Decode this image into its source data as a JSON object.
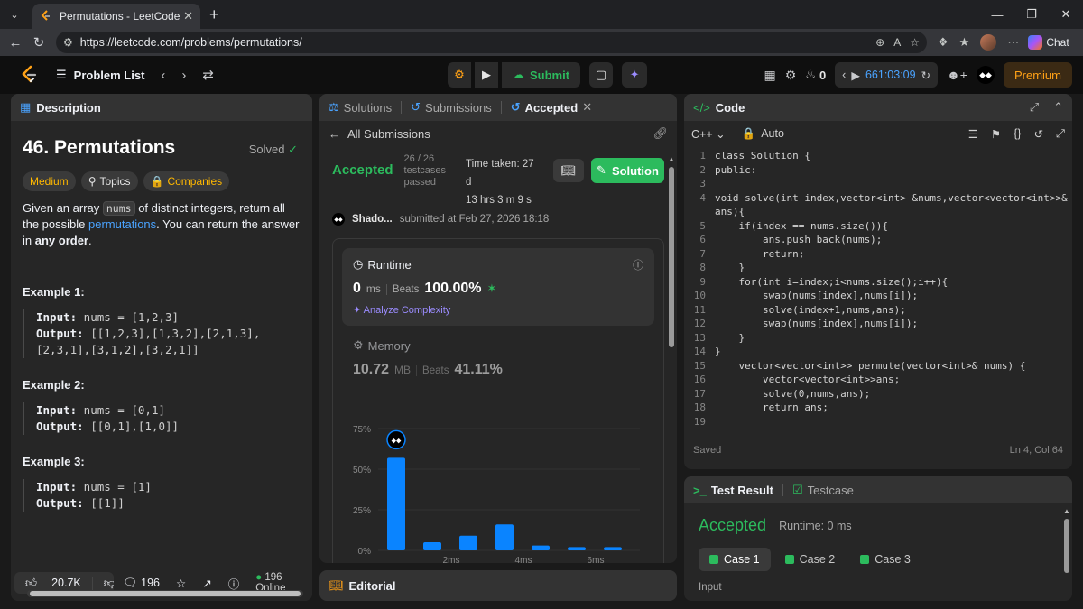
{
  "browser": {
    "tab_title": "Permutations - LeetCode",
    "url": "https://leetcode.com/problems/permutations/",
    "chat_label": "Chat"
  },
  "header": {
    "problem_list": "Problem List",
    "submit": "Submit",
    "streak": "0",
    "timer": "661:03:09",
    "premium": "Premium"
  },
  "description": {
    "tab": "Description",
    "title": "46. Permutations",
    "solved": "Solved",
    "difficulty": "Medium",
    "topics": "Topics",
    "companies": "Companies",
    "text_1": "Given an array ",
    "code_nums": "nums",
    "text_2": " of distinct integers, return all the possible ",
    "link": "permutations",
    "text_3": ". You can return the answer in ",
    "bold": "any order",
    "text_4": ".",
    "examples": [
      {
        "title": "Example 1:",
        "input_label": "Input:",
        "input": " nums = [1,2,3]",
        "output_label": "Output:",
        "output": " [[1,2,3],[1,3,2],[2,1,3],",
        "output_cont": "[2,3,1],[3,1,2],[3,2,1]]"
      },
      {
        "title": "Example 2:",
        "input_label": "Input:",
        "input": " nums = [0,1]",
        "output_label": "Output:",
        "output": " [[0,1],[1,0]]"
      },
      {
        "title": "Example 3:",
        "input_label": "Input:",
        "input": " nums = [1]",
        "output_label": "Output:",
        "output": " [[1]]"
      }
    ],
    "likes": "20.7K",
    "comments": "196",
    "online": "196 Online"
  },
  "submission": {
    "tabs": [
      "Solutions",
      "Submissions",
      "Accepted"
    ],
    "all_submissions": "All Submissions",
    "status": "Accepted",
    "testcases_line1": "26 / 26",
    "testcases_line2": "testcases",
    "testcases_line3": "passed",
    "time_taken": "Time taken: 27 d",
    "time_taken_2": "13 hrs 3 m 9 s",
    "solution_btn": "Solution",
    "author": "Shado...",
    "submitted": "submitted at Feb 27, 2026 18:18",
    "runtime_label": "Runtime",
    "runtime_value": "0",
    "runtime_unit": "ms",
    "beats_label": "Beats",
    "runtime_beats": "100.00%",
    "analyze": "Analyze Complexity",
    "memory_label": "Memory",
    "memory_value": "10.72",
    "memory_unit": "MB",
    "memory_beats": "41.11%"
  },
  "chart_data": {
    "type": "bar",
    "y_ticks": [
      "75%",
      "50%",
      "25%",
      "0%"
    ],
    "x_ticks": [
      "2ms",
      "4ms",
      "6ms"
    ],
    "values": [
      57,
      5,
      9,
      16,
      3,
      2,
      2
    ],
    "ylim": [
      0,
      75
    ],
    "highlight_index": 0
  },
  "editorial": {
    "label": "Editorial"
  },
  "code": {
    "tab": "Code",
    "language": "C++",
    "auto": "Auto",
    "lines": [
      "class Solution {",
      "public:",
      "",
      "void solve(int index,vector<int> &nums,vector<vector<int>>&",
      "ans){",
      "    if(index == nums.size()){",
      "        ans.push_back(nums);",
      "        return;",
      "    }",
      "    for(int i=index;i<nums.size();i++){",
      "        swap(nums[index],nums[i]);",
      "        solve(index+1,nums,ans);",
      "        swap(nums[index],nums[i]);",
      "    }",
      "}",
      "    vector<vector<int>> permute(vector<int>& nums) {",
      "        vector<vector<int>>ans;",
      "        solve(0,nums,ans);",
      "        return ans;",
      ""
    ],
    "line_numbers": [
      "1",
      "2",
      "3",
      "4",
      "",
      "5",
      "6",
      "7",
      "8",
      "9",
      "10",
      "11",
      "12",
      "13",
      "14",
      "15",
      "16",
      "17",
      "18",
      "19"
    ],
    "saved": "Saved",
    "position": "Ln 4, Col 64"
  },
  "test": {
    "tab_result": "Test Result",
    "tab_testcase": "Testcase",
    "status": "Accepted",
    "runtime": "Runtime: 0 ms",
    "cases": [
      "Case 1",
      "Case 2",
      "Case 3"
    ],
    "input_label": "Input"
  }
}
